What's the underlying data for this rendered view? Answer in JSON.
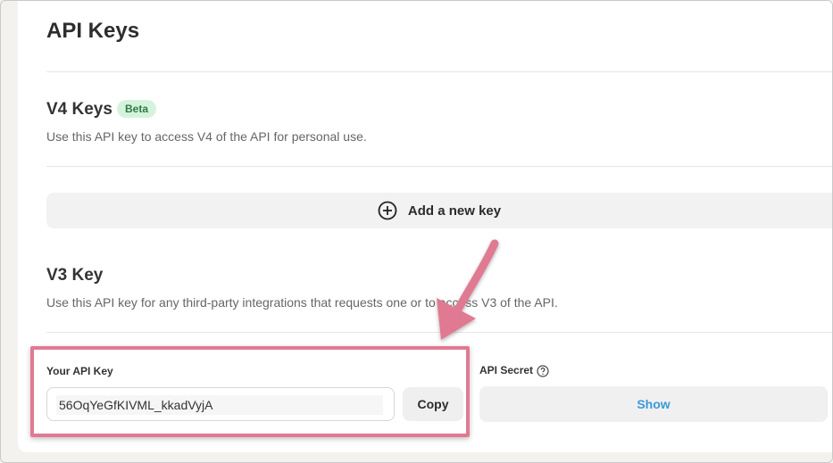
{
  "page": {
    "title": "API Keys"
  },
  "v4": {
    "title": "V4 Keys",
    "badge": "Beta",
    "description": "Use this API key to access V4 of the API for personal use.",
    "add_button_label": "Add a new key"
  },
  "v3": {
    "title": "V3 Key",
    "description": "Use this API key for any third-party integrations that requests one or to access V3 of the API.",
    "api_key_label": "Your API Key",
    "api_key_value": "56OqYeGfKIVML_kkadVyjA",
    "copy_label": "Copy",
    "api_secret_label": "API Secret",
    "show_label": "Show"
  },
  "colors": {
    "highlight": "#e07a92",
    "beta_bg": "#d5f3dc",
    "beta_text": "#2f7a45",
    "link_blue": "#3a9ad9"
  },
  "icons": {
    "add": "plus-circle-icon",
    "help": "question-circle-icon",
    "annotation": "arrow-annotation"
  }
}
